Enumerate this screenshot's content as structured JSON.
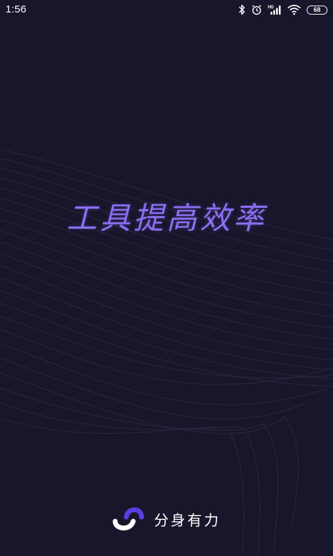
{
  "status_bar": {
    "time": "1:56",
    "battery": "68",
    "icons": [
      "bluetooth-icon",
      "alarm-icon",
      "hd-signal-icon",
      "wifi-icon",
      "battery-icon"
    ]
  },
  "splash": {
    "slogan": "工具提高效率",
    "brand_name": "分身有力"
  },
  "colors": {
    "background": "#18162a",
    "slogan": "#8b6ff0",
    "logo_accent": "#5b3fe0",
    "brand_text": "#ffffff"
  }
}
